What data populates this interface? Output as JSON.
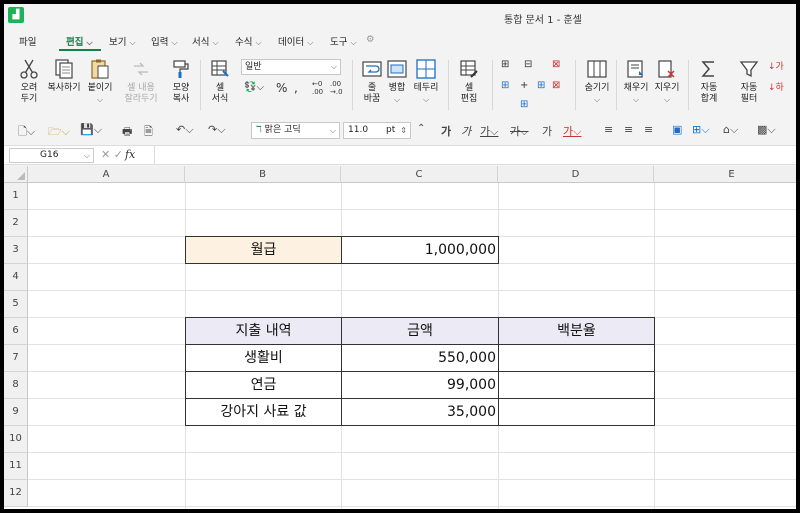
{
  "window": {
    "title": "통합 문서 1 - 훈셀",
    "logo": "app-logo"
  },
  "menu": {
    "items": [
      {
        "label": "파일",
        "chev": false
      },
      {
        "label": "편집",
        "chev": true,
        "active": true
      },
      {
        "label": "보기",
        "chev": true
      },
      {
        "label": "입력",
        "chev": true
      },
      {
        "label": "서식",
        "chev": true
      },
      {
        "label": "수식",
        "chev": true
      },
      {
        "label": "데이터",
        "chev": true
      },
      {
        "label": "도구",
        "chev": true
      }
    ]
  },
  "ribbon": {
    "cut": "오려\n두기",
    "copy": "복사하기",
    "paste": "붙이기",
    "paste_special": "셀 내용\n잘라두기",
    "format_painter": "모양\n복사",
    "cell_style": "셀\n서식",
    "number_format": "일반",
    "wrap": "줄\n바꿈",
    "merge": "병합",
    "border": "테두리",
    "cell_edit": "셀\n편집",
    "hide": "숨기기",
    "fill": "채우기",
    "clear": "지우기",
    "autosum": "자동\n합계",
    "autofilter": "자동\n필터"
  },
  "toolbar2": {
    "font_name": "맑은 고딕",
    "font_size": "11.0",
    "font_unit": "pt"
  },
  "formula_bar": {
    "name_box": "G16",
    "formula": ""
  },
  "sheet": {
    "columns": [
      "A",
      "B",
      "C",
      "D",
      "E"
    ],
    "rows": [
      "1",
      "2",
      "3",
      "4",
      "5",
      "6",
      "7",
      "8",
      "9",
      "10",
      "11",
      "12"
    ],
    "cells": {
      "B3": "월급",
      "C3": "1,000,000",
      "B6": "지출 내역",
      "C6": "금액",
      "D6": "백분율",
      "B7": "생활비",
      "C7": "550,000",
      "B8": "연금",
      "C8": "99,000",
      "B9": "강아지 사료 값",
      "C9": "35,000"
    },
    "colors": {
      "salary_fill": "#fdf1e2",
      "header_fill": "#ecebf5"
    }
  }
}
